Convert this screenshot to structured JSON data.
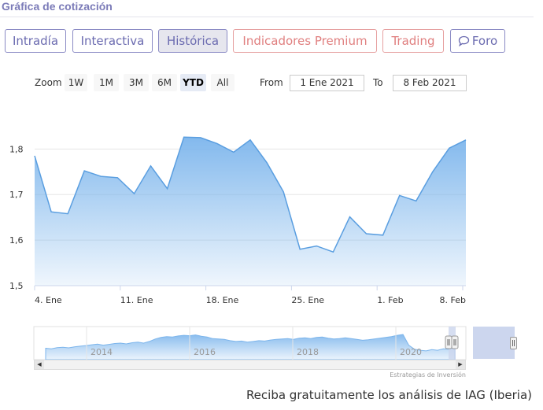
{
  "header": {
    "title": "Gráfica de cotización"
  },
  "tabs": [
    {
      "label": "Intradía"
    },
    {
      "label": "Interactiva"
    },
    {
      "label": "Histórica"
    },
    {
      "label": "Indicadores Premium"
    },
    {
      "label": "Trading"
    },
    {
      "label": "Foro"
    }
  ],
  "zoom": {
    "label": "Zoom",
    "buttons": [
      "1W",
      "1M",
      "3M",
      "6M",
      "YTD",
      "All"
    ],
    "active": "YTD"
  },
  "range": {
    "from_label": "From",
    "from_value": "1 Ene 2021",
    "to_label": "To",
    "to_value": "8 Feb 2021"
  },
  "chart_data": {
    "type": "area",
    "title": "",
    "xlabel": "",
    "ylabel": "",
    "ylim": [
      1.5,
      1.83
    ],
    "y_ticks": [
      "1,5",
      "1,6",
      "1,7",
      "1,8"
    ],
    "x_ticks": [
      "4. Ene",
      "11. Ene",
      "18. Ene",
      "25. Ene",
      "1. Feb",
      "8. Feb"
    ],
    "grid": true,
    "fill_color": "#7cb5ec",
    "series": [
      {
        "values": [
          1.785,
          1.662,
          1.658,
          1.752,
          1.74,
          1.737,
          1.702,
          1.763,
          1.713,
          1.826,
          1.825,
          1.812,
          1.793,
          1.82,
          1.77,
          1.706,
          1.58,
          1.587,
          1.574,
          1.651,
          1.614,
          1.611,
          1.698,
          1.686,
          1.75,
          1.802,
          1.82
        ]
      }
    ]
  },
  "navigator": {
    "year_labels": [
      "2014",
      "2016",
      "2018",
      "2020"
    ],
    "credit": "Estrategias de Inversión"
  },
  "footer": {
    "text": "Reciba gratuitamente los análisis de IAG (Iberia)"
  },
  "colors": {
    "accent": "#6b6bb0",
    "premium": "#e07f7f",
    "area": "#7cb5ec",
    "line": "#5a9ee0"
  }
}
